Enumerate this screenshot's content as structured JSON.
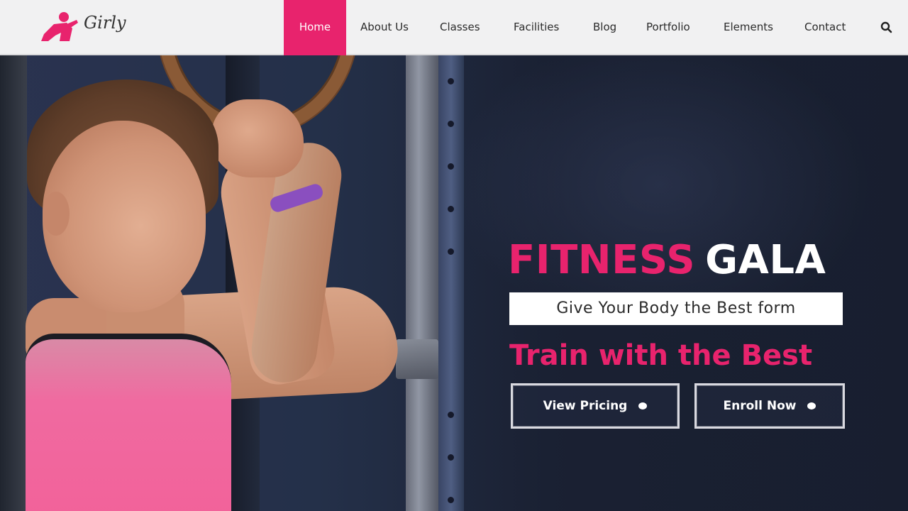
{
  "brand": {
    "logo_text": "Girly",
    "logo_color": "#e8236d"
  },
  "nav": {
    "items": [
      {
        "label": "Home",
        "active": true
      },
      {
        "label": "About Us",
        "active": false
      },
      {
        "label": "Classes",
        "active": false
      },
      {
        "label": "Facilities",
        "active": false
      },
      {
        "label": "Blog",
        "active": false
      },
      {
        "label": "Portfolio",
        "active": false
      },
      {
        "label": "Elements",
        "active": false
      },
      {
        "label": "Contact",
        "active": false
      }
    ],
    "search_icon": "search-icon",
    "active_color": "#e8236d"
  },
  "hero": {
    "title_part1": "FITNESS",
    "title_part2": "GALA",
    "tagline": "Give Your Body the Best form",
    "subtitle": "Train with the Best",
    "buttons": {
      "pricing_label": "View Pricing",
      "enroll_label": "Enroll Now"
    },
    "accent_color": "#e8236d"
  }
}
